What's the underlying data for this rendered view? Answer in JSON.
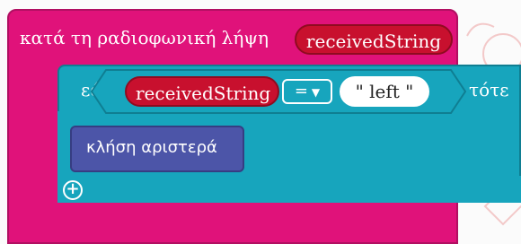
{
  "event_block": {
    "label": "κατά τη ραδιοφωνική λήψη",
    "variable": "receivedString"
  },
  "if_block": {
    "if_label": "εάν",
    "then_label": "τότε",
    "condition": {
      "left_variable": "receivedString",
      "operator": "=",
      "right_value": "\" left \""
    },
    "add_icon": "plus-circle-icon"
  },
  "call_block": {
    "label": "κλήση αριστερά"
  },
  "colors": {
    "event": "#e0127a",
    "if": "#17a5bd",
    "variable": "#c8102e",
    "function": "#4c55a8"
  }
}
